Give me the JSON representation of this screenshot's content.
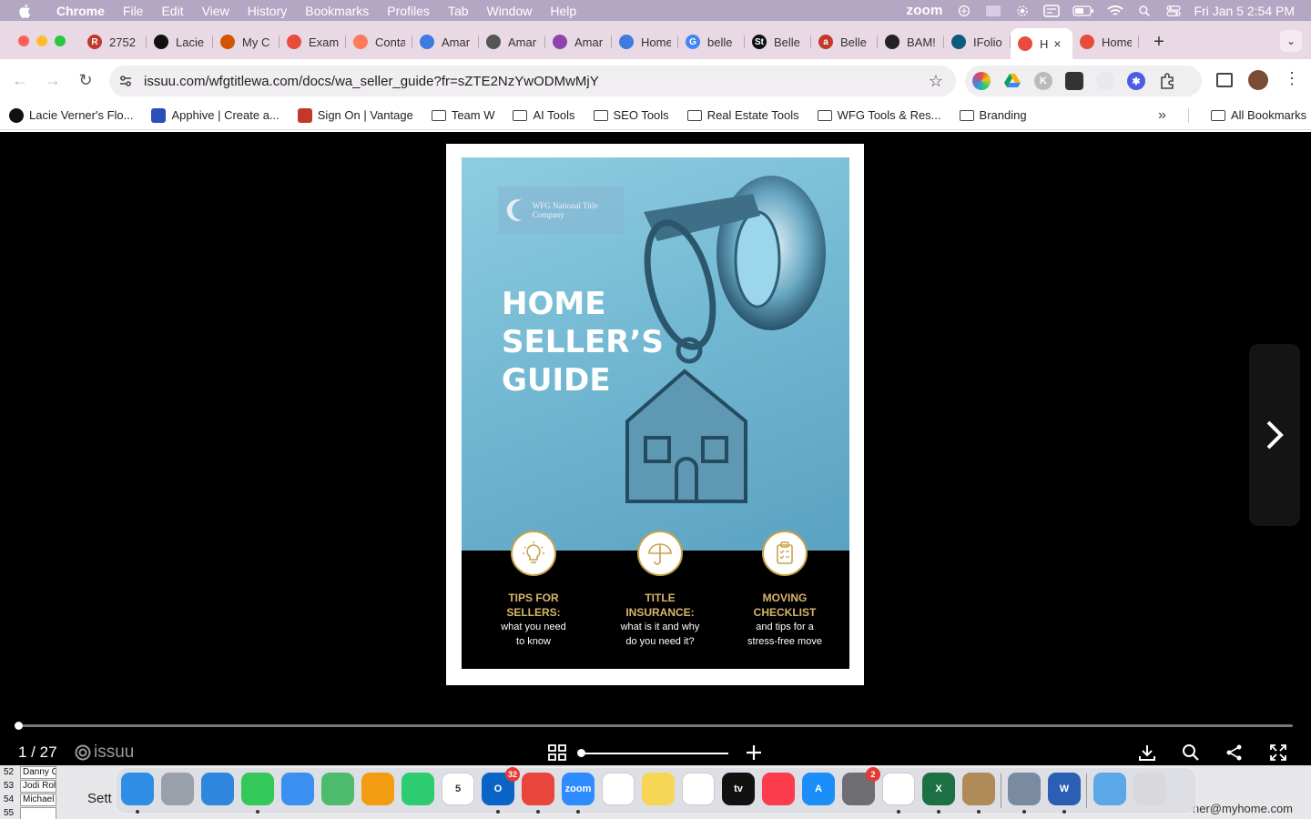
{
  "menubar": {
    "app_name": "Chrome",
    "items": [
      "File",
      "Edit",
      "View",
      "History",
      "Bookmarks",
      "Profiles",
      "Tab",
      "Window",
      "Help"
    ],
    "zoom_label": "zoom",
    "datetime": "Fri Jan 5  2:54 PM"
  },
  "tabs": [
    {
      "title": "2752",
      "favicon_text": "R",
      "favicon_color": "#c0392b"
    },
    {
      "title": "Lacie",
      "favicon_text": "",
      "favicon_color": "#111111"
    },
    {
      "title": "My C",
      "favicon_text": "",
      "favicon_color": "#d35400"
    },
    {
      "title": "Exam",
      "favicon_text": "",
      "favicon_color": "#e74c3c"
    },
    {
      "title": "Conta",
      "favicon_text": "",
      "favicon_color": "#ff7a59"
    },
    {
      "title": "Amar",
      "favicon_text": "",
      "favicon_color": "#3d7be0"
    },
    {
      "title": "Amar",
      "favicon_text": "",
      "favicon_color": "#555555"
    },
    {
      "title": "Amar",
      "favicon_text": "",
      "favicon_color": "#8e44ad"
    },
    {
      "title": "Home",
      "favicon_text": "",
      "favicon_color": "#3d7be0"
    },
    {
      "title": "belle",
      "favicon_text": "G",
      "favicon_color": "#4285f4"
    },
    {
      "title": "Belle",
      "favicon_text": "St",
      "favicon_color": "#111111"
    },
    {
      "title": "Belle",
      "favicon_text": "a",
      "favicon_color": "#c0392b"
    },
    {
      "title": "BAM!",
      "favicon_text": "",
      "favicon_color": "#222222"
    },
    {
      "title": "IFolio",
      "favicon_text": "",
      "favicon_color": "#0b5c7d"
    },
    {
      "title": "H",
      "favicon_text": "",
      "favicon_color": "#e74c3c",
      "active": true
    },
    {
      "title": "Home",
      "favicon_text": "",
      "favicon_color": "#e74c3c"
    }
  ],
  "toolbar": {
    "url": "issuu.com/wfgtitlewa.com/docs/wa_seller_guide?fr=sZTE2NzYwODMwMjY"
  },
  "bookmarks": [
    {
      "label": "Lacie Verner's Flo...",
      "type": "site",
      "icon_color": "#111111"
    },
    {
      "label": "Apphive | Create a...",
      "type": "site",
      "icon_color": "#2b4fb8"
    },
    {
      "label": "Sign On | Vantage",
      "type": "site",
      "icon_color": "#c0392b"
    },
    {
      "label": "Team W",
      "type": "folder"
    },
    {
      "label": "AI Tools",
      "type": "folder"
    },
    {
      "label": "SEO Tools",
      "type": "folder"
    },
    {
      "label": "Real Estate Tools",
      "type": "folder"
    },
    {
      "label": "WFG Tools & Res...",
      "type": "folder"
    },
    {
      "label": "Branding",
      "type": "folder"
    }
  ],
  "bookmarks_all": "All Bookmarks",
  "document": {
    "logo_text": "WFG National Title Company",
    "title_lines": [
      "HOME",
      "SELLER’S",
      "GUIDE"
    ],
    "features": [
      {
        "title_lines": [
          "TIPS FOR",
          "SELLERS:"
        ],
        "sub_lines": [
          "what you need",
          "to know"
        ],
        "icon": "lightbulb-icon"
      },
      {
        "title_lines": [
          "TITLE",
          "INSURANCE:"
        ],
        "sub_lines": [
          "what is it and why",
          "do you need it?"
        ],
        "icon": "umbrella-icon"
      },
      {
        "title_lines": [
          "MOVING",
          "CHECKLIST"
        ],
        "sub_lines": [
          "and tips for a",
          "stress-free move"
        ],
        "icon": "clipboard-icon"
      }
    ],
    "accent_color": "#d8b66a"
  },
  "viewer": {
    "page_indicator": "1 / 27",
    "brand": "issuu",
    "reading_progress": 0.0
  },
  "desktop": {
    "sheet_rows": [
      {
        "num": "52",
        "name": "Danny O"
      },
      {
        "num": "53",
        "name": "Jodi Roh"
      },
      {
        "num": "54",
        "name": "Michael"
      },
      {
        "num": "55",
        "name": ""
      }
    ],
    "sett_label": "Sett",
    "email_fragment": "ner@myhome.com"
  },
  "dock": {
    "apps": [
      {
        "name": "Finder",
        "color": "#2e8ee6",
        "label": "",
        "running": true
      },
      {
        "name": "Launchpad",
        "color": "#9aa0aa",
        "label": "",
        "running": false
      },
      {
        "name": "Safari",
        "color": "#2e86de",
        "label": "",
        "running": false
      },
      {
        "name": "Messages",
        "color": "#34c759",
        "label": "",
        "running": true
      },
      {
        "name": "Mail",
        "color": "#3a8ff0",
        "label": "",
        "running": false
      },
      {
        "name": "Maps",
        "color": "#4cbb6c",
        "label": "",
        "running": false
      },
      {
        "name": "Photos",
        "color": "#f39c12",
        "label": "",
        "running": false
      },
      {
        "name": "FaceTime",
        "color": "#2ecc71",
        "label": "",
        "running": false
      },
      {
        "name": "Calendar",
        "color": "#ffffff",
        "label": "5",
        "running": false
      },
      {
        "name": "Outlook",
        "color": "#0a64c8",
        "label": "O",
        "badge": "32",
        "running": true
      },
      {
        "name": "Chrome",
        "color": "#e8453c",
        "label": "",
        "running": true
      },
      {
        "name": "Zoom",
        "color": "#2d8cff",
        "label": "zoom",
        "running": true
      },
      {
        "name": "Reminders",
        "color": "#ffffff",
        "label": "",
        "running": false
      },
      {
        "name": "Notes",
        "color": "#f7d655",
        "label": "",
        "running": false
      },
      {
        "name": "Freeform",
        "color": "#ffffff",
        "label": "",
        "running": false
      },
      {
        "name": "TV",
        "color": "#111111",
        "label": "tv",
        "running": false
      },
      {
        "name": "Music",
        "color": "#fa3c4c",
        "label": "",
        "running": false
      },
      {
        "name": "App Store",
        "color": "#1c8ef9",
        "label": "A",
        "running": false
      },
      {
        "name": "System Settings",
        "color": "#6d6d72",
        "label": "",
        "badge": "2",
        "running": false
      },
      {
        "name": "Slack",
        "color": "#ffffff",
        "label": "",
        "running": true
      },
      {
        "name": "Excel",
        "color": "#1d7044",
        "label": "X",
        "running": true
      },
      {
        "name": "Contacts",
        "color": "#b08a57",
        "label": "",
        "running": true
      },
      {
        "name": "Preview",
        "color": "#7a8aa0",
        "label": "",
        "running": true
      },
      {
        "name": "Word",
        "color": "#2b5fb3",
        "label": "W",
        "running": true
      },
      {
        "name": "Downloads",
        "color": "#5aa8e8",
        "label": "",
        "running": false
      },
      {
        "name": "Trash",
        "color": "#d9d9dd",
        "label": "",
        "running": false
      }
    ]
  }
}
